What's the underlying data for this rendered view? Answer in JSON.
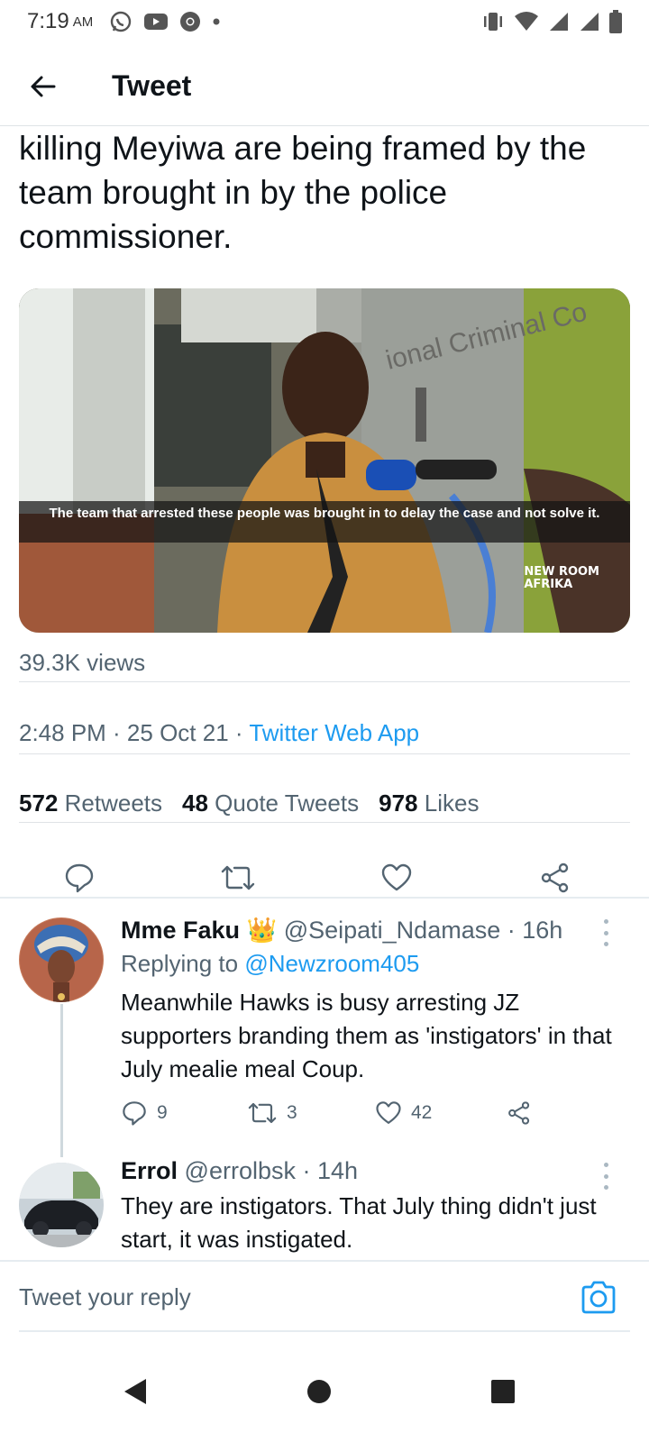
{
  "status_bar": {
    "time": "7:19",
    "ampm": "AM"
  },
  "header": {
    "title": "Tweet"
  },
  "tweet": {
    "text": "killing Meyiwa are being framed by the team brought in by the police commissioner.",
    "media": {
      "caption": "The team that arrested these people was brought in to delay the case and not solve it.",
      "logo_line1": "NEW ROOM",
      "logo_line2": "AFRIKA"
    },
    "views": "39.3K views",
    "timestamp": "2:48 PM · 25 Oct 21 · ",
    "source": "Twitter Web App",
    "stats": {
      "retweets_count": "572",
      "retweets_label": "Retweets",
      "quotes_count": "48",
      "quotes_label": "Quote Tweets",
      "likes_count": "978",
      "likes_label": "Likes"
    }
  },
  "replies": [
    {
      "name": "Mme Faku",
      "badge": "👑",
      "handle": "@Seipati_Ndamase · 16h",
      "replying_prefix": "Replying to ",
      "replying_to": "@Newzroom405",
      "text": "Meanwhile Hawks is busy arresting JZ supporters branding them as 'instigators'  in that July mealie meal Coup.",
      "reply_count": "9",
      "retweet_count": "3",
      "like_count": "42"
    },
    {
      "name": "Errol",
      "handle": "@errolbsk · 14h",
      "text": "They are instigators. That July thing didn't just start, it was instigated."
    }
  ],
  "compose": {
    "placeholder": "Tweet your reply"
  },
  "colors": {
    "accent": "#1d9bf0",
    "secondary_text": "#536471",
    "primary_text": "#0f1419"
  },
  "icons": [
    "whatsapp-icon",
    "youtube-icon",
    "chrome-icon",
    "vibrate-icon",
    "wifi-icon",
    "signal-icon",
    "battery-icon",
    "back-arrow-icon",
    "reply-icon",
    "retweet-icon",
    "like-icon",
    "share-icon",
    "more-icon",
    "camera-icon",
    "nav-back-icon",
    "nav-home-icon",
    "nav-recents-icon"
  ]
}
